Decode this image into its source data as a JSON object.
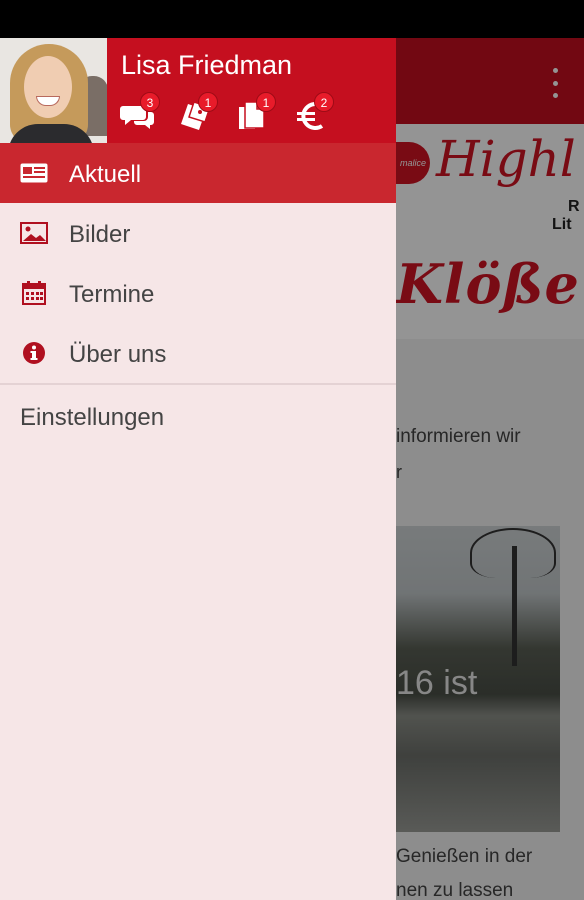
{
  "drawer": {
    "user_name": "Lisa Friedman",
    "counters": [
      {
        "icon": "chat-icon",
        "count": "3"
      },
      {
        "icon": "tickets-icon",
        "count": "1"
      },
      {
        "icon": "documents-icon",
        "count": "1"
      },
      {
        "icon": "euro-icon",
        "count": "2"
      }
    ],
    "menu": [
      {
        "icon": "newspaper-icon",
        "label": "Aktuell",
        "active": true
      },
      {
        "icon": "image-icon",
        "label": "Bilder"
      },
      {
        "icon": "calendar-icon",
        "label": "Termine"
      },
      {
        "icon": "info-icon",
        "label": "Über uns"
      }
    ],
    "settings_label": "Einstellungen"
  },
  "background_app": {
    "banner_badge": "malice",
    "banner_script": "Highl",
    "banner_r": "R",
    "banner_lit": "Lit",
    "banner_klosse": "Klöße",
    "text_1": "informieren wir",
    "text_2": "r",
    "photo_text": "16 ist",
    "text_3": "Genießen in der",
    "text_4": "nen zu lassen"
  },
  "colors": {
    "brand_red": "#c50f1f",
    "active_item": "#c9272f",
    "drawer_bg": "#f6e6e7",
    "badge_red": "#e81b2a"
  }
}
